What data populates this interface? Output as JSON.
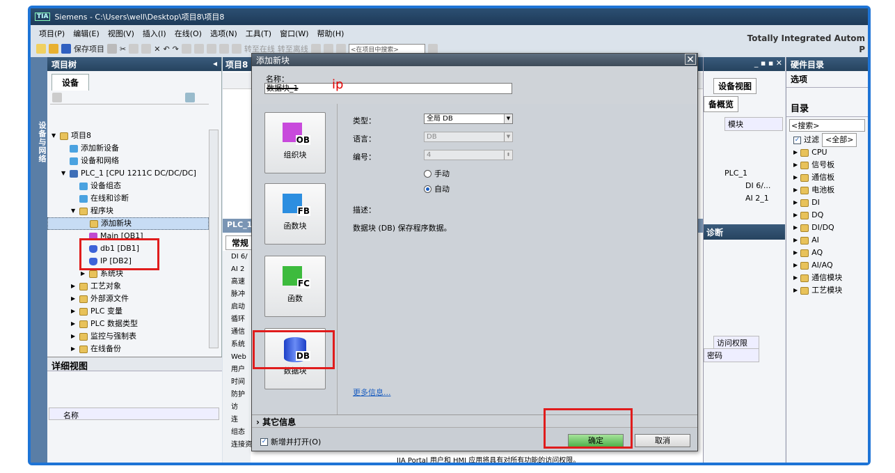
{
  "window": {
    "tia": "TIA",
    "title": "Siemens  -  C:\\Users\\well\\Desktop\\项目8\\项目8"
  },
  "menu": [
    "项目(P)",
    "编辑(E)",
    "视图(V)",
    "插入(I)",
    "在线(O)",
    "选项(N)",
    "工具(T)",
    "窗口(W)",
    "帮助(H)"
  ],
  "brand": "Totally Integrated Autom",
  "brand2": "P",
  "toolbar": {
    "save": "保存项目",
    "go_online": "转至在线",
    "go_offline": "转至离线",
    "search_placeholder": "<在项目中搜索>"
  },
  "side_strip": "设备与网络",
  "project_tree": {
    "title": "项目树",
    "tab": "设备",
    "items": [
      {
        "label": "项目8",
        "indent": 0,
        "icon": "project-icon"
      },
      {
        "label": "添加新设备",
        "indent": 1,
        "icon": "add-device-icon"
      },
      {
        "label": "设备和网络",
        "indent": 1,
        "icon": "network-icon"
      },
      {
        "label": "PLC_1 [CPU 1211C DC/DC/DC]",
        "indent": 1,
        "icon": "plc-icon"
      },
      {
        "label": "设备组态",
        "indent": 2,
        "icon": "device-config-icon"
      },
      {
        "label": "在线和诊断",
        "indent": 2,
        "icon": "diagnostics-icon"
      },
      {
        "label": "程序块",
        "indent": 2,
        "icon": "folder-icon"
      },
      {
        "label": "添加新块",
        "indent": 3,
        "icon": "add-block-icon"
      },
      {
        "label": "Main [OB1]",
        "indent": 3,
        "icon": "ob-icon"
      },
      {
        "label": "db1 [DB1]",
        "indent": 3,
        "icon": "db-icon"
      },
      {
        "label": "IP [DB2]",
        "indent": 3,
        "icon": "db-icon"
      },
      {
        "label": "系统块",
        "indent": 3,
        "icon": "folder-icon"
      },
      {
        "label": "工艺对象",
        "indent": 2,
        "icon": "folder-icon"
      },
      {
        "label": "外部源文件",
        "indent": 2,
        "icon": "folder-icon"
      },
      {
        "label": "PLC 变量",
        "indent": 2,
        "icon": "folder-icon"
      },
      {
        "label": "PLC 数据类型",
        "indent": 2,
        "icon": "folder-icon"
      },
      {
        "label": "监控与强制表",
        "indent": 2,
        "icon": "folder-icon"
      },
      {
        "label": "在线备份",
        "indent": 2,
        "icon": "folder-icon"
      }
    ]
  },
  "detail_view": {
    "title": "详细视图",
    "col_name": "名称"
  },
  "middle": {
    "title": "项目8",
    "plc_tab": "PLC_1",
    "general_tab": "常规",
    "props": [
      "DI 6/",
      "AI 2",
      "高速",
      "脉冲",
      "启动",
      "循环",
      "通信",
      "系统",
      "Web",
      "用户",
      "时间",
      "防护",
      "访",
      "连",
      "组态",
      "连接资源"
    ],
    "footer": "IIA Portal 用户和 HMI 应用将具有对所有功能的访问权限。"
  },
  "right_panel": {
    "device_view": "设备视图",
    "overview": "备概览",
    "module": "模块",
    "plc": "PLC_1",
    "row1": "DI 6/...",
    "row2": "AI 2_1",
    "diag": "诊断",
    "access": "访问权限",
    "password": "密码"
  },
  "hardware": {
    "title": "硬件目录",
    "options": "选项",
    "catalog": "目录",
    "search": "<搜索>",
    "filter": "过滤",
    "filter_val": "<全部>",
    "items": [
      "CPU",
      "信号板",
      "通信板",
      "电池板",
      "DI",
      "DQ",
      "DI/DQ",
      "AI",
      "AQ",
      "AI/AQ",
      "通信模块",
      "工艺模块"
    ]
  },
  "dialog": {
    "title": "添加新块",
    "name_label": "名称：",
    "name_value": "数据块_1",
    "annotation": "ip",
    "blocks": [
      {
        "tag": "OB",
        "label": "组织块"
      },
      {
        "tag": "FB",
        "label": "函数块"
      },
      {
        "tag": "FC",
        "label": "函数"
      },
      {
        "tag": "DB",
        "label": "数据块"
      }
    ],
    "type_label": "类型：",
    "type_value": "全局 DB",
    "lang_label": "语言：",
    "lang_value": "DB",
    "num_label": "编号：",
    "num_value": "4",
    "manual": "手动",
    "auto": "自动",
    "desc_label": "描述：",
    "desc_text": "数据块 (DB) 保存程序数据。",
    "more": "更多信息...",
    "other": "其它信息",
    "open_check": "新增并打开(O)",
    "ok": "确定",
    "cancel": "取消"
  }
}
